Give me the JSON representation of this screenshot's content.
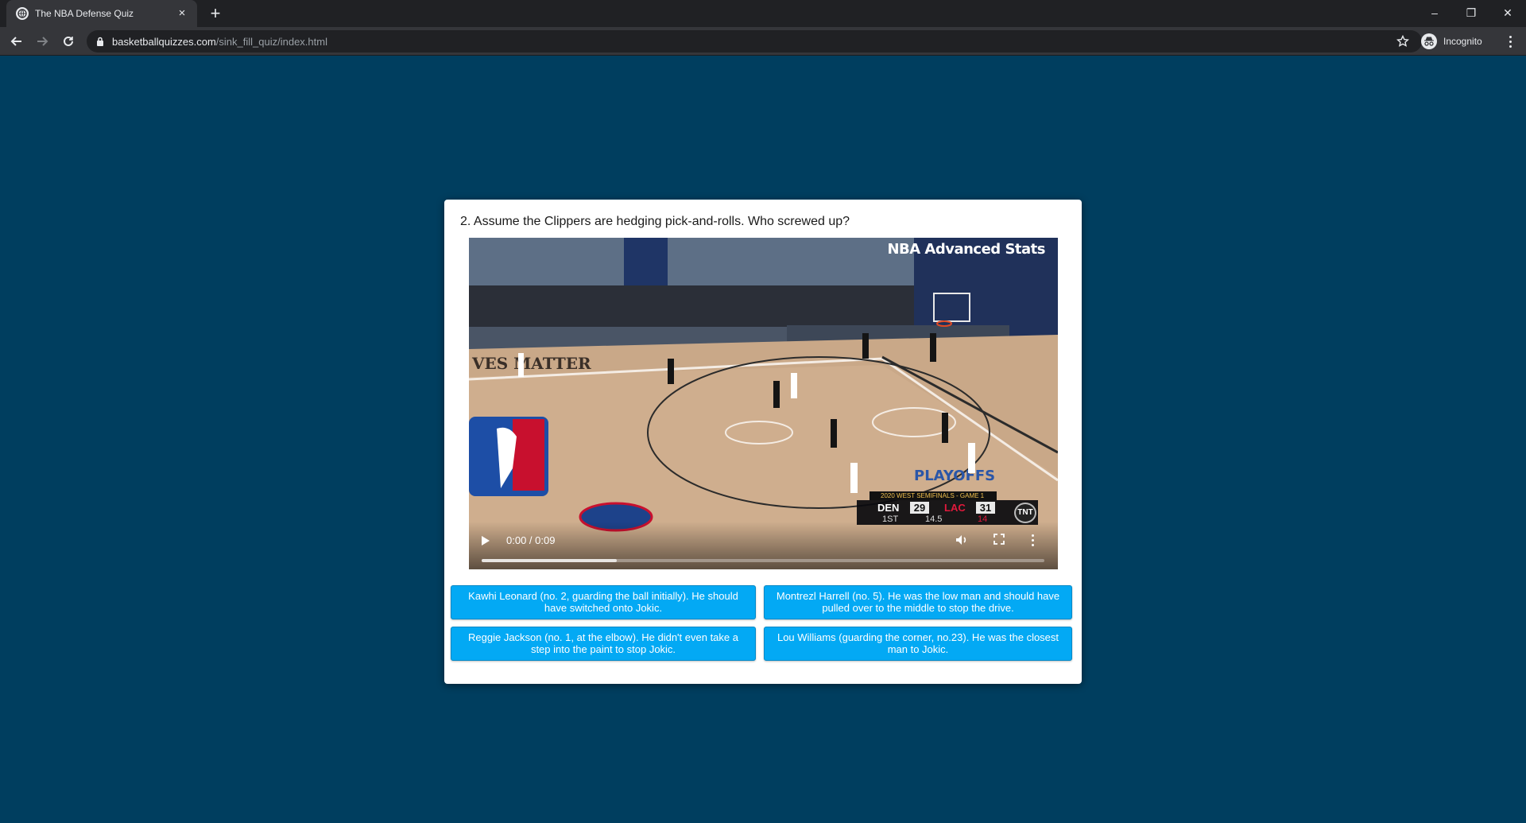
{
  "browser": {
    "tab_title": "The NBA Defense Quiz",
    "tab_close": "×",
    "new_tab": "+",
    "url_host": "basketballquizzes.com",
    "url_path": "/sink_fill_quiz/index.html",
    "profile_label": "Incognito",
    "window_minimize": "–",
    "window_restore": "❐",
    "window_close": "✕"
  },
  "quiz": {
    "question": "2. Assume the Clippers are hedging pick-and-rolls. Who screwed up?",
    "video": {
      "watermark": "NBA Advanced Stats",
      "scorebug": {
        "header": "2020 WEST SEMIFINALS - GAME 1",
        "team1": "DEN",
        "score1": "29",
        "team2": "LAC",
        "score2": "31",
        "period": "1ST",
        "shot_clock": "14.5",
        "game_clock": "14",
        "network": "TNT"
      },
      "time": "0:00 / 0:09",
      "progress": 0.24
    },
    "answers": [
      "Kawhi Leonard (no. 2, guarding the ball initially). He should have switched onto Jokic.",
      "Montrezl Harrell (no. 5). He was the low man and should have pulled over to the middle to stop the drive.",
      "Reggie Jackson (no. 1, at the elbow). He didn't even take a step into the paint to stop Jokic.",
      "Lou Williams (guarding the corner, no.23). He was the closest man to Jokic."
    ]
  },
  "colors": {
    "page_bg": "#003e5f",
    "answer_bg": "#03a9f4",
    "chrome_dark": "#202124",
    "chrome_mid": "#35363a"
  }
}
